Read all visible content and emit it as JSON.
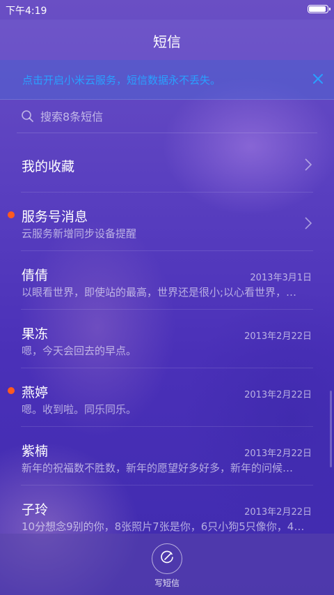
{
  "status": {
    "time": "下午4:19",
    "battery_level": 0.95
  },
  "header": {
    "title": "短信"
  },
  "banner": {
    "text": "点击开启小米云服务，短信数据永不丢失。",
    "close_icon": "close-icon",
    "text_color": "#2aa0ff"
  },
  "search": {
    "placeholder": "搜索8条短信",
    "value": "",
    "icon": "search-icon"
  },
  "conversations": [
    {
      "name": "我的收藏",
      "preview": "",
      "date": "",
      "unread": false,
      "chevron": true
    },
    {
      "name": "服务号消息",
      "preview": "云服务新增同步设备提醒",
      "date": "",
      "unread": true,
      "chevron": true
    },
    {
      "name": "倩倩",
      "preview": "以眼看世界，即使站的最高，世界还是很小;以心看世界，…",
      "date": "2013年3月1日",
      "unread": false,
      "chevron": false
    },
    {
      "name": "果冻",
      "preview": "嗯，今天会回去的早点。",
      "date": "2013年2月22日",
      "unread": false,
      "chevron": false
    },
    {
      "name": "燕婷",
      "preview": "嗯。收到啦。同乐同乐。",
      "date": "2013年2月22日",
      "unread": true,
      "chevron": false
    },
    {
      "name": "紫楠",
      "preview": "新年的祝福数不胜数，新年的愿望好多好多，新年的问候…",
      "date": "2013年2月22日",
      "unread": false,
      "chevron": false
    },
    {
      "name": "子玲",
      "preview": "10分想念9别的你，8张照片7张是你，6只小狗5只像你，4…",
      "date": "2013年2月22日",
      "unread": false,
      "chevron": false
    }
  ],
  "compose": {
    "label": "写短信",
    "icon": "compose-icon"
  },
  "colors": {
    "unread_dot": "#ff5a1e",
    "accent": "#2aa0ff"
  }
}
